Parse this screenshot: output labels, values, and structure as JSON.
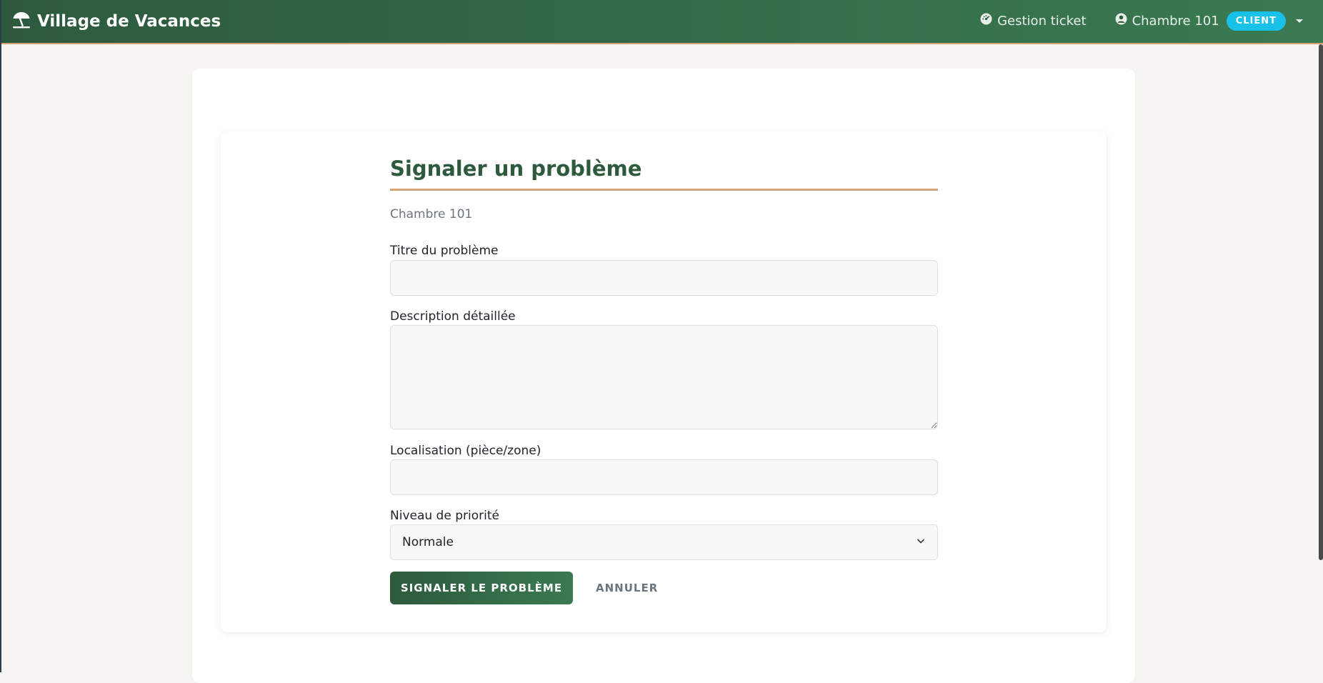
{
  "navbar": {
    "brand": "Village de Vacances",
    "brand_icon": "umbrella-beach-icon",
    "gestion_ticket": "Gestion ticket",
    "gestion_icon": "gauge-icon",
    "user_label": "Chambre 101",
    "user_icon": "user-circle-icon",
    "role_badge": "CLIENT"
  },
  "form": {
    "title": "Signaler un problème",
    "subtitle": "Chambre 101",
    "title_label": "Titre du problème",
    "title_value": "",
    "description_label": "Description détaillée",
    "description_value": "",
    "location_label": "Localisation (pièce/zone)",
    "location_value": "",
    "priority_label": "Niveau de priorité",
    "priority_selected": "Normale",
    "submit_label": "SIGNALER LE PROBLÈME",
    "cancel_label": "ANNULER"
  },
  "colors": {
    "primary_green": "#2d5a3d",
    "accent_tan": "#d4a373",
    "badge_cyan": "#17c1e8"
  }
}
